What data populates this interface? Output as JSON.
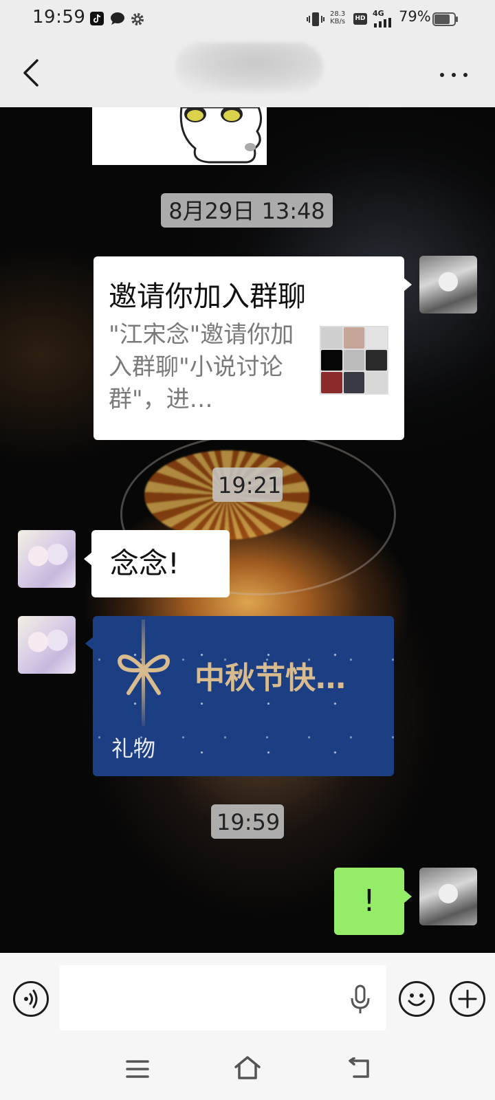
{
  "status_bar": {
    "time": "19:59",
    "network_speed": "28.3",
    "network_speed_unit": "KB/s",
    "hd": "HD",
    "signal": "4G",
    "battery": "79%",
    "icons": [
      "tiktok-icon",
      "message-icon",
      "gear-icon",
      "vibrate-icon",
      "signal-icon",
      "battery-icon"
    ]
  },
  "nav": {
    "back_icon": "chevron-left-icon",
    "more_icon": "more-horizontal-icon"
  },
  "messages": {
    "ts1": "8月29日 13:48",
    "invite": {
      "title": "邀请你加入群聊",
      "description": "\"江宋念\"邀请你加入群聊\"小说讨论群\"，进…"
    },
    "ts2": "19:21",
    "friend_text": "念念!",
    "gift": {
      "title": "中秋节快…",
      "label": "礼物"
    },
    "ts3": "19:59",
    "my_text": "!"
  },
  "input": {
    "value": "",
    "placeholder": ""
  },
  "colors": {
    "my_bubble": "#95ec69",
    "gift_card": "#1c3f83",
    "gift_gold": "#d8bc8f",
    "bar_bg": "#ededed"
  }
}
